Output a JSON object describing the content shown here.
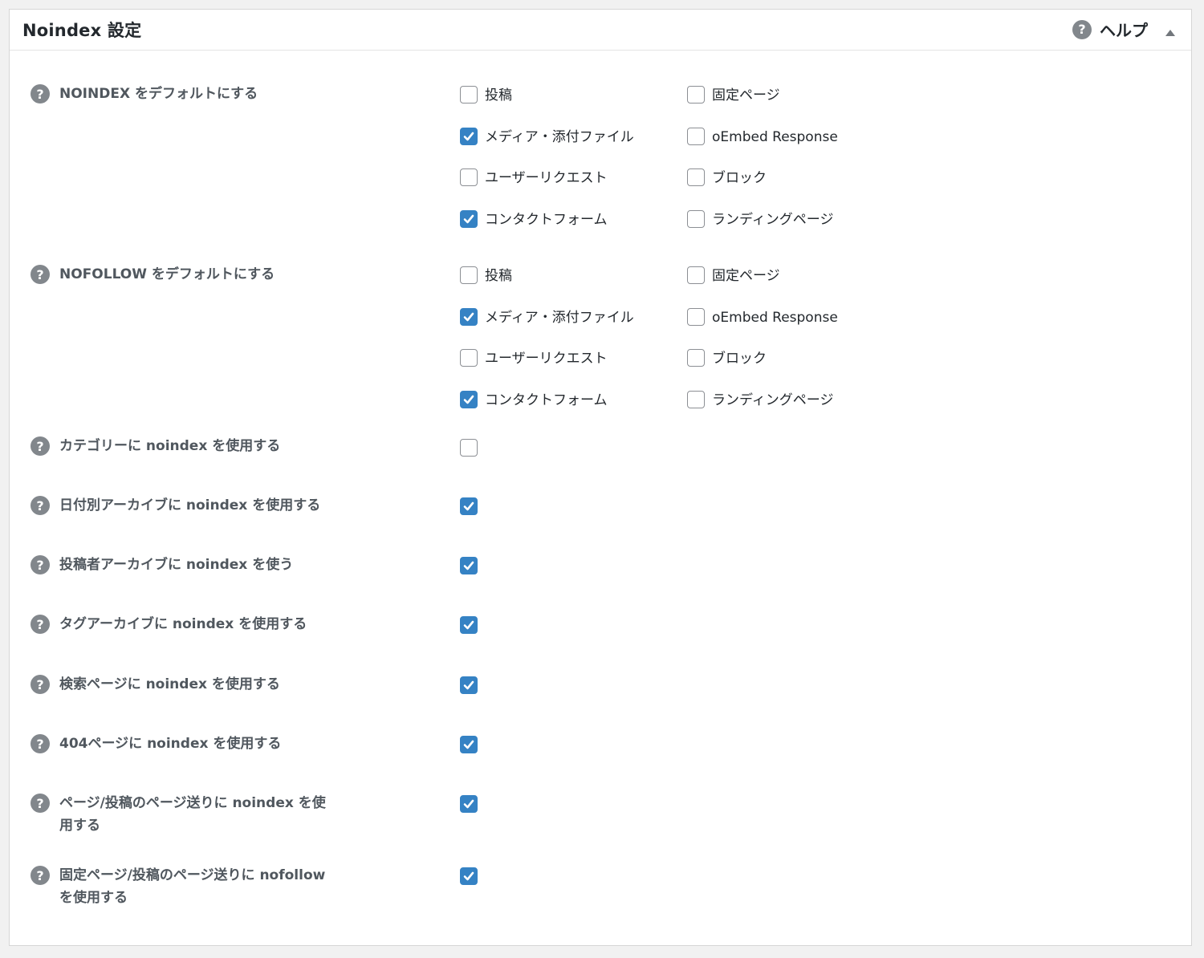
{
  "panel": {
    "title": "Noindex 設定",
    "help_label": "ヘルプ"
  },
  "noindex_default": {
    "label": "NOINDEX をデフォルトにする",
    "options": [
      {
        "label": "投稿",
        "checked": false
      },
      {
        "label": "固定ページ",
        "checked": false
      },
      {
        "label": "メディア・添付ファイル",
        "checked": true
      },
      {
        "label": "oEmbed Response",
        "checked": false
      },
      {
        "label": "ユーザーリクエスト",
        "checked": false
      },
      {
        "label": "ブロック",
        "checked": false
      },
      {
        "label": "コンタクトフォーム",
        "checked": true
      },
      {
        "label": "ランディングページ",
        "checked": false
      }
    ]
  },
  "nofollow_default": {
    "label": "NOFOLLOW をデフォルトにする",
    "options": [
      {
        "label": "投稿",
        "checked": false
      },
      {
        "label": "固定ページ",
        "checked": false
      },
      {
        "label": "メディア・添付ファイル",
        "checked": true
      },
      {
        "label": "oEmbed Response",
        "checked": false
      },
      {
        "label": "ユーザーリクエスト",
        "checked": false
      },
      {
        "label": "ブロック",
        "checked": false
      },
      {
        "label": "コンタクトフォーム",
        "checked": true
      },
      {
        "label": "ランディングページ",
        "checked": false
      }
    ]
  },
  "single_settings": [
    {
      "label": "カテゴリーに noindex を使用する",
      "checked": false
    },
    {
      "label": "日付別アーカイブに noindex を使用する",
      "checked": true
    },
    {
      "label": "投稿者アーカイブに noindex を使う",
      "checked": true
    },
    {
      "label": "タグアーカイブに noindex を使用する",
      "checked": true
    },
    {
      "label": "検索ページに noindex を使用する",
      "checked": true
    },
    {
      "label": "404ページに noindex を使用する",
      "checked": true
    },
    {
      "label": "ページ/投稿のページ送りに noindex を使用する",
      "checked": true
    },
    {
      "label": "固定ページ/投稿のページ送りに nofollow を使用する",
      "checked": true
    }
  ],
  "icons": {
    "help": "question-circle-icon",
    "toggle": "triangle-up-icon",
    "check": "checkmark-icon"
  },
  "colors": {
    "checkbox_checked": "#3582c4",
    "help_icon": "#82878c"
  }
}
